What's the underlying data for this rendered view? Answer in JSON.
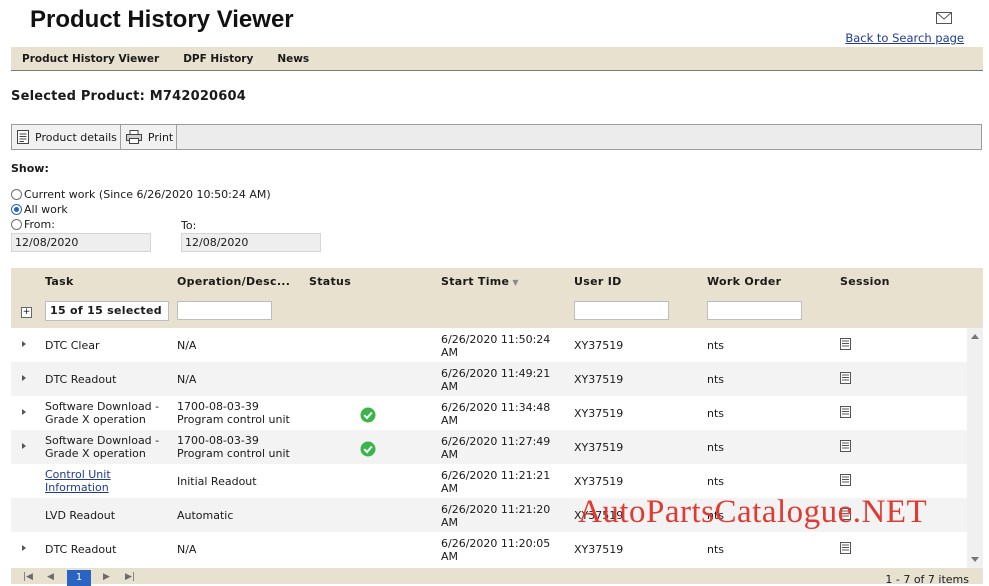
{
  "header": {
    "title": "Product History Viewer",
    "back_link": "Back to Search page"
  },
  "nav": {
    "items": [
      "Product History Viewer",
      "DPF History",
      "News"
    ]
  },
  "selected_product": "Selected Product: M742020604",
  "toolbar": {
    "product_details": "Product details",
    "print": "Print"
  },
  "show": {
    "label": "Show:",
    "options": [
      {
        "label": "Current work (Since 6/26/2020 10:50:24 AM)",
        "checked": false
      },
      {
        "label": "All work",
        "checked": true
      },
      {
        "label": "From:",
        "checked": false
      }
    ],
    "to_label": "To:",
    "from_value": "12/08/2020",
    "to_value": "12/08/2020"
  },
  "grid": {
    "columns": [
      "Task",
      "Operation/Desc...",
      "Status",
      "Start Time",
      "User ID",
      "Work Order",
      "Session"
    ],
    "task_filter": "15 of 15 selected",
    "rows": [
      {
        "task": "DTC Clear",
        "task_link": false,
        "expandable": true,
        "op": [
          "N/A"
        ],
        "status": "",
        "time": [
          "6/26/2020 11:50:24",
          "AM"
        ],
        "user": "XY37519",
        "wo": "nts"
      },
      {
        "task": "DTC Readout",
        "task_link": false,
        "expandable": true,
        "op": [
          "N/A"
        ],
        "status": "",
        "time": [
          "6/26/2020 11:49:21",
          "AM"
        ],
        "user": "XY37519",
        "wo": "nts"
      },
      {
        "task": "Software Download - Grade X operation",
        "task_link": false,
        "expandable": true,
        "op": [
          "1700-08-03-39",
          "Program control unit"
        ],
        "status": "ok",
        "time": [
          "6/26/2020 11:34:48",
          "AM"
        ],
        "user": "XY37519",
        "wo": "nts"
      },
      {
        "task": "Software Download - Grade X operation",
        "task_link": false,
        "expandable": true,
        "op": [
          "1700-08-03-39",
          "Program control unit"
        ],
        "status": "ok",
        "time": [
          "6/26/2020 11:27:49",
          "AM"
        ],
        "user": "XY37519",
        "wo": "nts"
      },
      {
        "task": "Control Unit Information",
        "task_link": true,
        "expandable": false,
        "op": [
          "Initial Readout"
        ],
        "status": "",
        "time": [
          "6/26/2020 11:21:21",
          "AM"
        ],
        "user": "XY37519",
        "wo": "nts"
      },
      {
        "task": "LVD Readout",
        "task_link": false,
        "expandable": false,
        "op": [
          "Automatic"
        ],
        "status": "",
        "time": [
          "6/26/2020 11:21:20",
          "AM"
        ],
        "user": "XY37519",
        "wo": "nts"
      },
      {
        "task": "DTC Readout",
        "task_link": false,
        "expandable": true,
        "op": [
          "N/A"
        ],
        "status": "",
        "time": [
          "6/26/2020 11:20:05",
          "AM"
        ],
        "user": "XY37519",
        "wo": "nts"
      }
    ]
  },
  "pager": {
    "current_page": "1",
    "info": "1 - 7 of 7 items"
  },
  "watermark": "AutoPartsCatalogue.NET",
  "colors": {
    "header_bg": "#e9e1cf",
    "link": "#1f3a93",
    "status_ok": "#3bb54a",
    "watermark": "#e03a32"
  }
}
